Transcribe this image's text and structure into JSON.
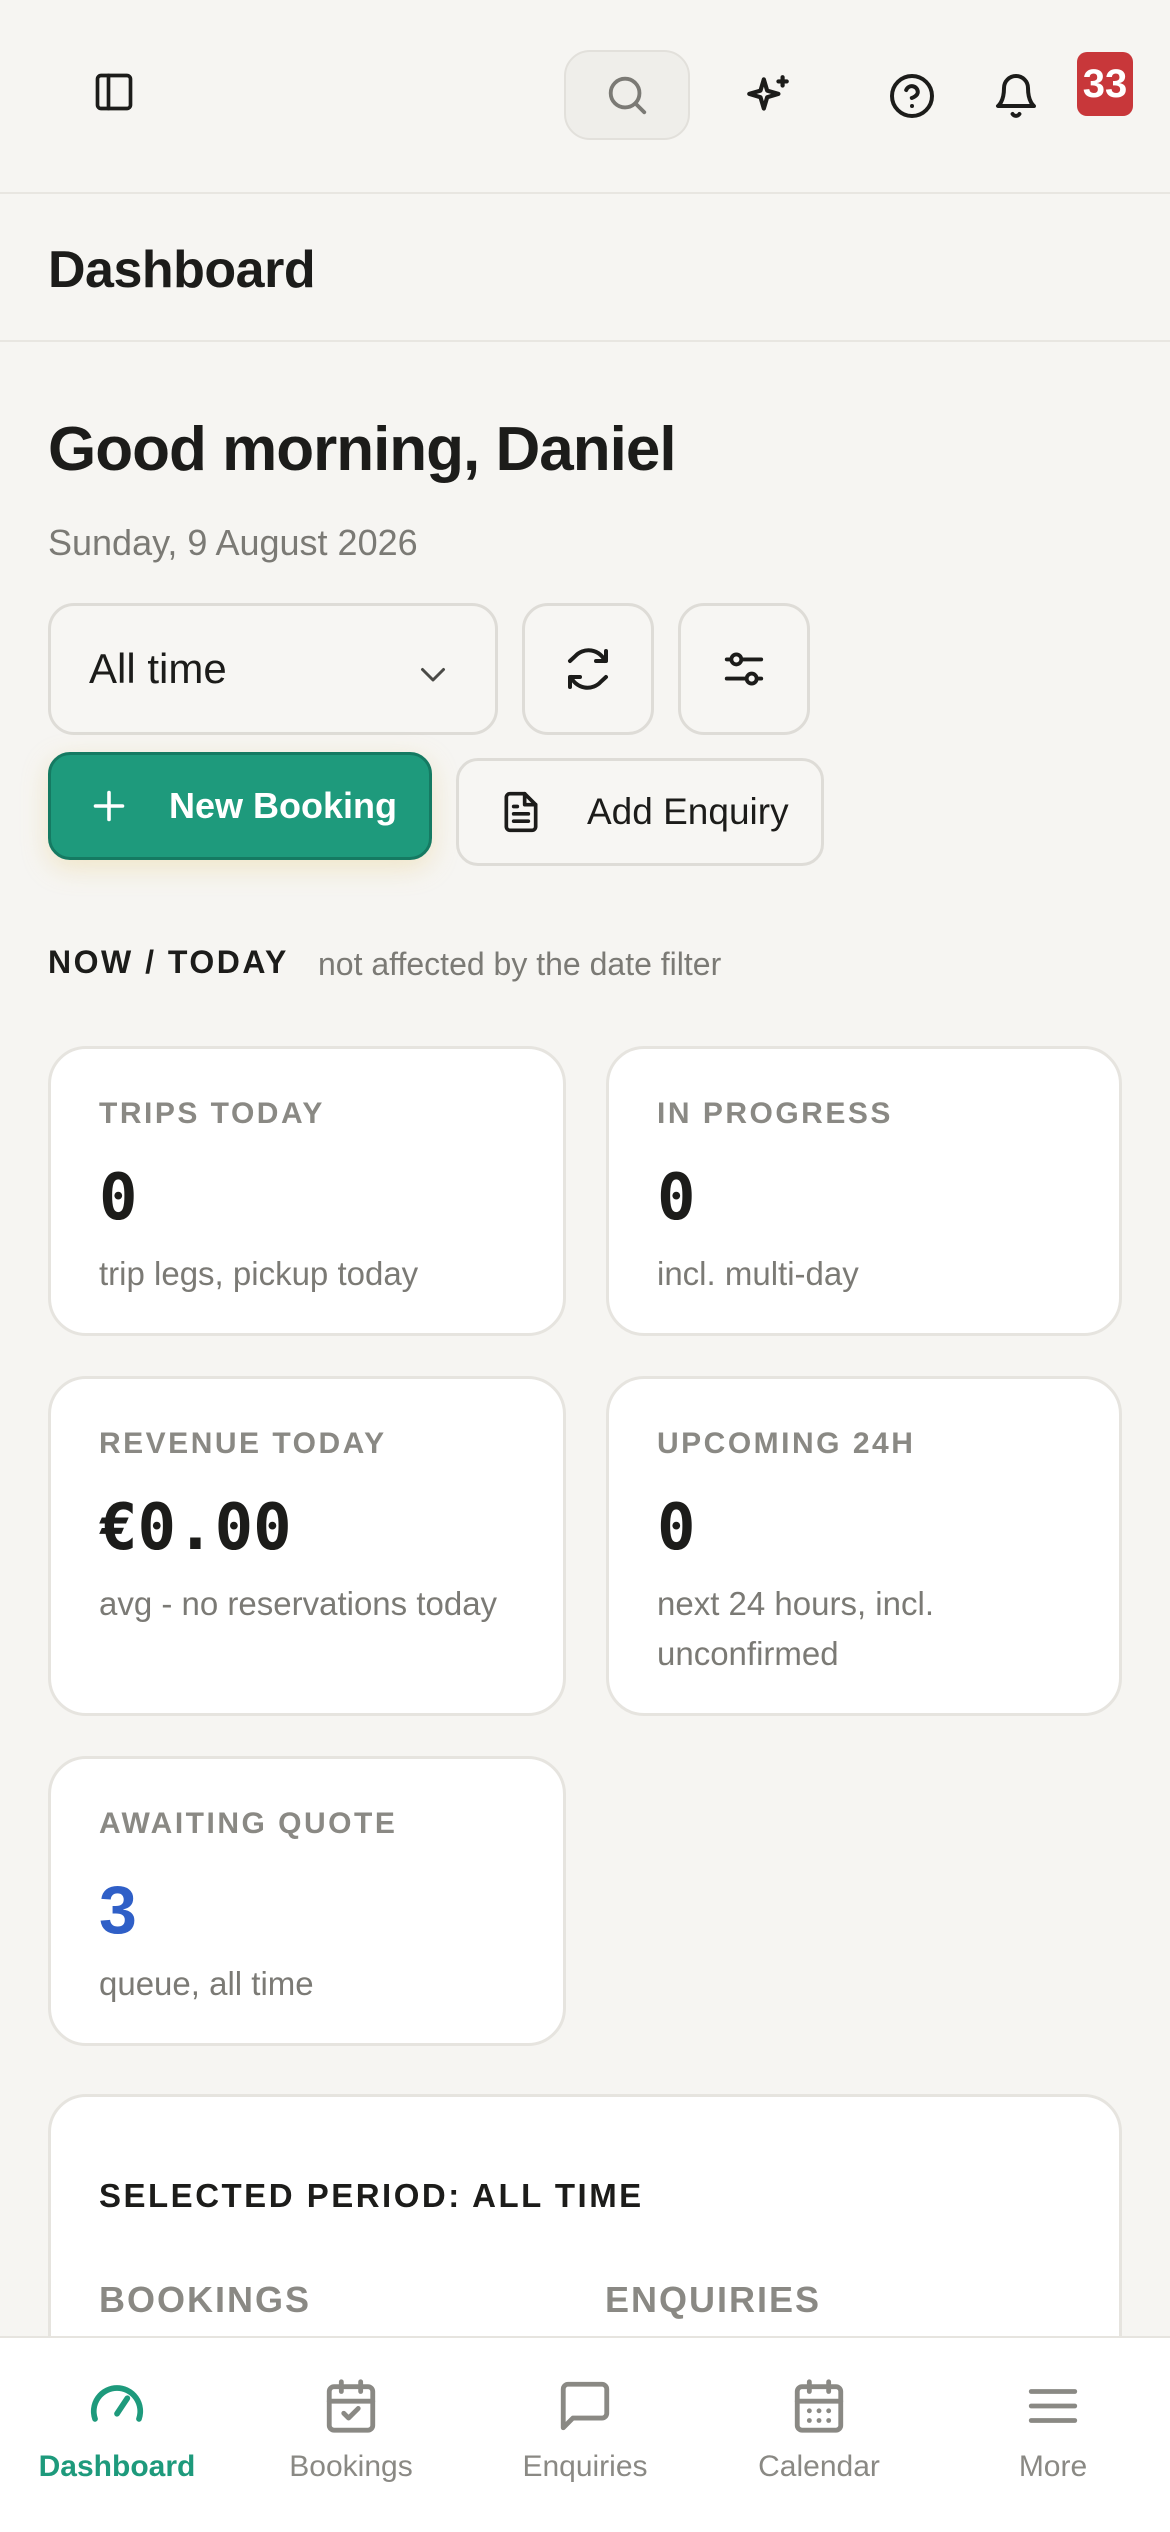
{
  "topbar": {
    "notification_count": "33"
  },
  "page": {
    "title": "Dashboard",
    "greeting": "Good morning, Daniel",
    "date": "Sunday, 9 August 2026"
  },
  "filters": {
    "range_value": "All time"
  },
  "actions": {
    "new_booking": "New Booking",
    "add_enquiry": "Add Enquiry"
  },
  "now_section": {
    "label": "NOW / TODAY",
    "note": "not affected by the date filter"
  },
  "cards": [
    {
      "label": "TRIPS TODAY",
      "value": "0",
      "sub": "trip legs, pickup today"
    },
    {
      "label": "IN PROGRESS",
      "value": "0",
      "sub": "incl. multi-day"
    },
    {
      "label": "REVENUE TODAY",
      "value": "€0.00",
      "sub": "avg - no reservations today"
    },
    {
      "label": "UPCOMING 24H",
      "value": "0",
      "sub": "next 24 hours, incl. unconfirmed"
    },
    {
      "label": "AWAITING QUOTE",
      "value": "3",
      "sub": "queue, all time"
    }
  ],
  "period": {
    "title": "SELECTED PERIOD: ALL TIME",
    "col_bookings": "BOOKINGS",
    "col_enquiries": "ENQUIRIES"
  },
  "nav": [
    {
      "label": "Dashboard",
      "icon": "gauge-icon",
      "active": true
    },
    {
      "label": "Bookings",
      "icon": "calendar-check-icon"
    },
    {
      "label": "Enquiries",
      "icon": "message-icon"
    },
    {
      "label": "Calendar",
      "icon": "calendar-icon"
    },
    {
      "label": "More",
      "icon": "menu-icon"
    }
  ],
  "colors": {
    "accent": "#1e9a7c",
    "badge": "#c8373a",
    "link_value": "#2f5fc7",
    "background": "#f6f5f2"
  }
}
